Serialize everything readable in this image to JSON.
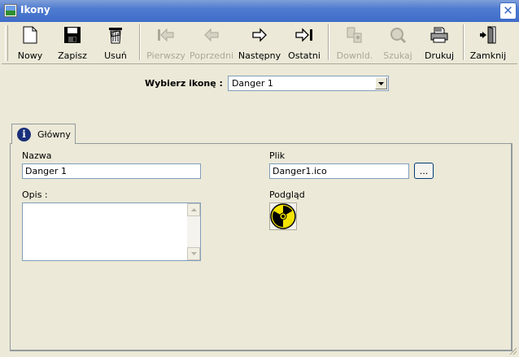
{
  "window": {
    "title": "Ikony",
    "close_symbol": "✕"
  },
  "toolbar": {
    "buttons": [
      {
        "label": "Nowy",
        "icon": "new-document-icon",
        "enabled": true
      },
      {
        "label": "Zapisz",
        "icon": "floppy-disk-icon",
        "enabled": true
      },
      {
        "label": "Usuń",
        "icon": "trash-bin-icon",
        "enabled": true
      },
      {
        "label": "Pierwszy",
        "icon": "first-record-icon",
        "enabled": false
      },
      {
        "label": "Poprzedni",
        "icon": "previous-record-icon",
        "enabled": false
      },
      {
        "label": "Następny",
        "icon": "next-record-icon",
        "enabled": true
      },
      {
        "label": "Ostatni",
        "icon": "last-record-icon",
        "enabled": true
      },
      {
        "label": "Downld.",
        "icon": "download-icon",
        "enabled": false
      },
      {
        "label": "Szukaj",
        "icon": "search-icon",
        "enabled": false
      },
      {
        "label": "Drukuj",
        "icon": "printer-icon",
        "enabled": true
      },
      {
        "label": "Zamknij",
        "icon": "exit-door-icon",
        "enabled": true
      }
    ]
  },
  "selector": {
    "label": "Wybierz ikonę :",
    "value": "Danger 1"
  },
  "tabs": [
    {
      "label": "Główny",
      "icon": "info-icon",
      "active": true
    }
  ],
  "form": {
    "name_label": "Nazwa",
    "name_value": "Danger 1",
    "description_label": "Opis :",
    "description_value": "",
    "file_label": "Plik",
    "file_value": "Danger1.ico",
    "browse_label": "...",
    "preview_label": "Podgląd",
    "preview_icon": "radiation-hazard-icon"
  },
  "colors": {
    "titlebar": "#3f6cc8",
    "window_bg": "#ece9d8",
    "hazard_yellow": "#f5e400",
    "hazard_black": "#000000"
  }
}
